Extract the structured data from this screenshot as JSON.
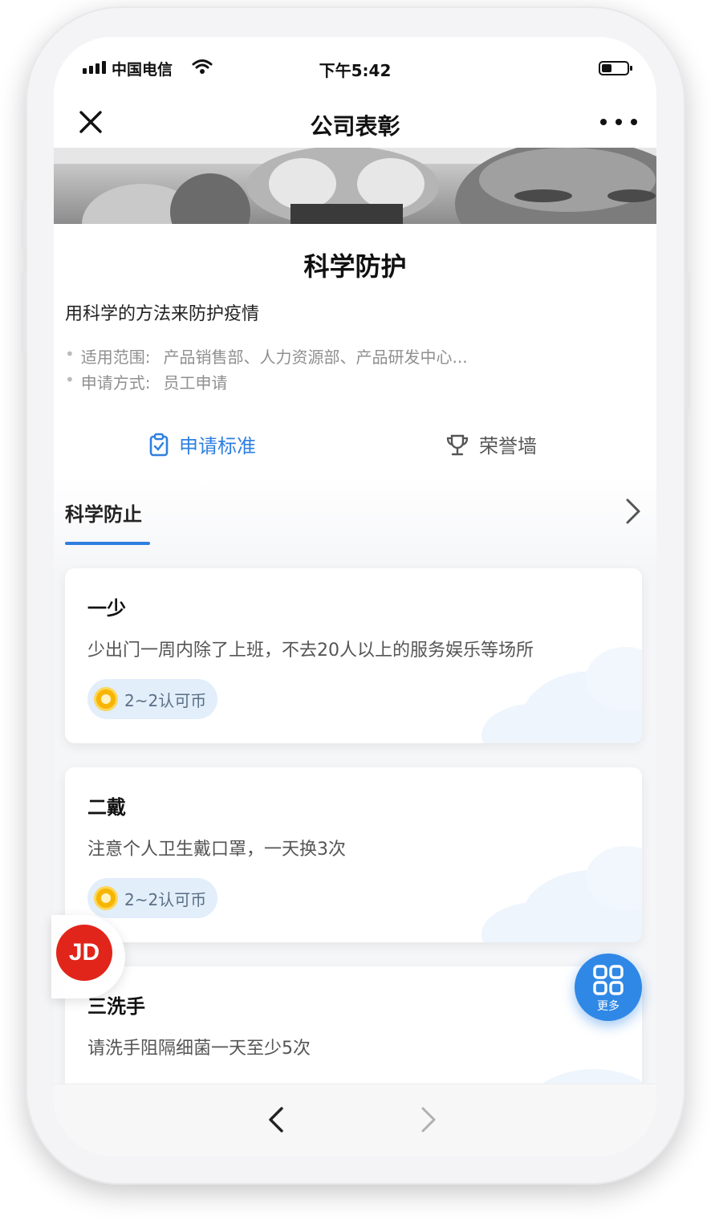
{
  "status_bar": {
    "carrier": "中国电信",
    "time": "下午5:42"
  },
  "navbar": {
    "title": "公司表彰"
  },
  "header": {
    "title": "科学防护",
    "subtitle": "用科学的方法来防护疫情",
    "scope_label": "适用范围:",
    "scope_value": "产品销售部、人力资源部、产品研发中心...",
    "method_label": "申请方式:",
    "method_value": "员工申请"
  },
  "tabs": [
    {
      "label": "申请标准",
      "icon": "clipboard-icon",
      "active": true
    },
    {
      "label": "荣誉墙",
      "icon": "trophy-icon",
      "active": false
    }
  ],
  "section": {
    "title": "科学防止"
  },
  "cards": [
    {
      "title": "一少",
      "description": "少出门一周内除了上班，不去20人以上的服务娱乐等场所",
      "reward": "2~2认可币"
    },
    {
      "title": "二戴",
      "description": "注意个人卫生戴口罩，一天换3次",
      "reward": "2~2认可币"
    },
    {
      "title": "三洗手",
      "description": "请洗手阻隔细菌一天至少5次",
      "reward": ""
    }
  ],
  "floating": {
    "jd_label": "JD",
    "more_label": "更多"
  },
  "colors": {
    "accent": "#2f7fe0",
    "jd_red": "#e1251b",
    "coin": "#f7b500"
  }
}
